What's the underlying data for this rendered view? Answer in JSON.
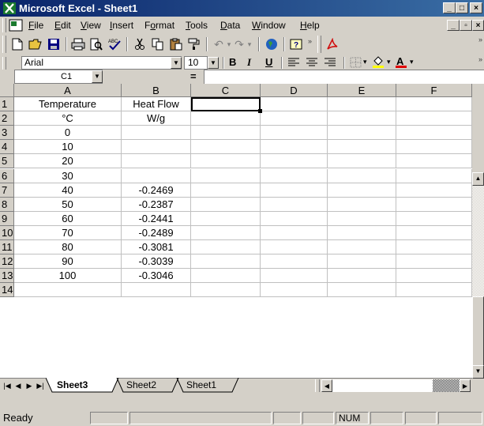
{
  "window": {
    "title": "Microsoft Excel - Sheet1",
    "colors": {
      "titlebar_start": "#0a246a",
      "titlebar_end": "#3a6ea5",
      "chrome": "#d4d0c8",
      "active_tab": "#ffffff"
    }
  },
  "menu": {
    "items": [
      "File",
      "Edit",
      "View",
      "Insert",
      "Format",
      "Tools",
      "Data",
      "Window",
      "Help"
    ]
  },
  "toolbar": {
    "standard_icons": [
      "new-icon",
      "open-icon",
      "save-icon",
      "print-icon",
      "print-preview-icon",
      "spelling-icon",
      "cut-icon",
      "copy-icon",
      "paste-icon",
      "format-painter-icon",
      "undo-icon",
      "redo-icon",
      "web-icon",
      "help-icon",
      "pdf-icon"
    ],
    "font_name": "Arial",
    "font_size": "10",
    "bold": "B",
    "italic": "I",
    "underline": "U"
  },
  "formula_bar": {
    "name_box": "C1",
    "equals": "=",
    "value": ""
  },
  "grid": {
    "columns": [
      "A",
      "B",
      "C",
      "D",
      "E",
      "F"
    ],
    "rows": [
      {
        "num": "1",
        "cells": [
          "Temperature",
          "Heat Flow",
          "",
          "",
          "",
          ""
        ]
      },
      {
        "num": "2",
        "cells": [
          "°C",
          "W/g",
          "",
          "",
          "",
          ""
        ]
      },
      {
        "num": "3",
        "cells": [
          "0",
          "",
          "",
          "",
          "",
          ""
        ]
      },
      {
        "num": "4",
        "cells": [
          "10",
          "",
          "",
          "",
          "",
          ""
        ]
      },
      {
        "num": "5",
        "cells": [
          "20",
          "",
          "",
          "",
          "",
          ""
        ]
      },
      {
        "num": "6",
        "cells": [
          "30",
          "",
          "",
          "",
          "",
          ""
        ]
      },
      {
        "num": "7",
        "cells": [
          "40",
          "-0.2469",
          "",
          "",
          "",
          ""
        ]
      },
      {
        "num": "8",
        "cells": [
          "50",
          "-0.2387",
          "",
          "",
          "",
          ""
        ]
      },
      {
        "num": "9",
        "cells": [
          "60",
          "-0.2441",
          "",
          "",
          "",
          ""
        ]
      },
      {
        "num": "10",
        "cells": [
          "70",
          "-0.2489",
          "",
          "",
          "",
          ""
        ]
      },
      {
        "num": "11",
        "cells": [
          "80",
          "-0.3081",
          "",
          "",
          "",
          ""
        ]
      },
      {
        "num": "12",
        "cells": [
          "90",
          "-0.3039",
          "",
          "",
          "",
          ""
        ]
      },
      {
        "num": "13",
        "cells": [
          "100",
          "-0.3046",
          "",
          "",
          "",
          ""
        ]
      },
      {
        "num": "14",
        "cells": [
          "",
          "",
          "",
          "",
          "",
          ""
        ]
      }
    ],
    "active_cell": "C1"
  },
  "sheets": {
    "tabs": [
      "Sheet3",
      "Sheet2",
      "Sheet1"
    ],
    "active": "Sheet3"
  },
  "status": {
    "text": "Ready",
    "num": "NUM"
  }
}
